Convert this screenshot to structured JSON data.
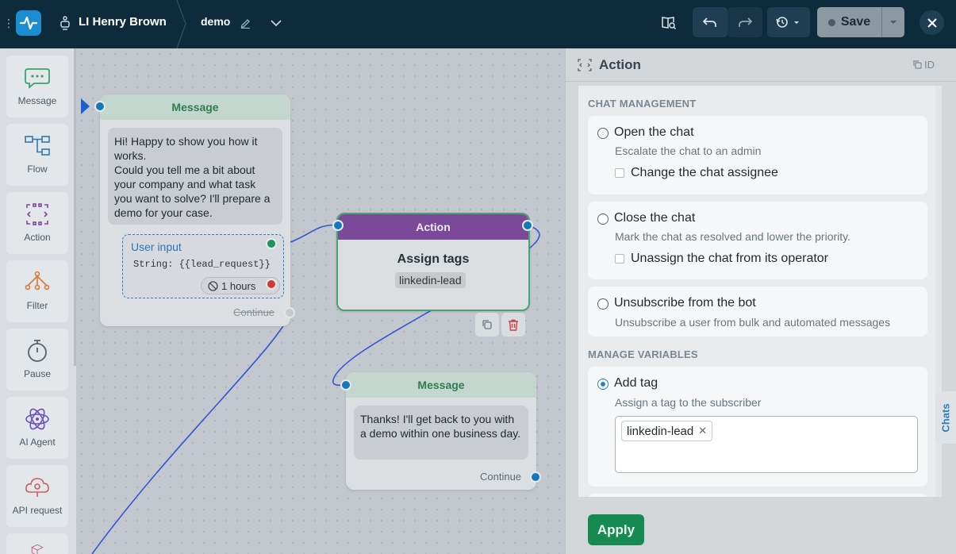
{
  "topbar": {
    "bot_name": "LI Henry Brown",
    "flow_name": "demo",
    "save_label": "Save"
  },
  "palette": {
    "items": [
      {
        "label": "Message",
        "icon": "chat-bubble-icon"
      },
      {
        "label": "Flow",
        "icon": "flow-icon"
      },
      {
        "label": "Action",
        "icon": "action-icon"
      },
      {
        "label": "Filter",
        "icon": "filter-icon"
      },
      {
        "label": "Pause",
        "icon": "stopwatch-icon"
      },
      {
        "label": "AI Agent",
        "icon": "atom-icon"
      },
      {
        "label": "API request",
        "icon": "api-cloud-icon"
      }
    ]
  },
  "canvas": {
    "message1": {
      "header": "Message",
      "text": "Hi! Happy to show you how it works.\nCould you tell me a bit about your company and what task you want to solve? I'll prepare a demo for your case.",
      "user_input_label": "User input",
      "user_input_var": "String: {{lead_request}}",
      "timeout": "1 hours",
      "continue_label": "Continue"
    },
    "action": {
      "header": "Action",
      "title": "Assign tags",
      "tag": "linkedin-lead"
    },
    "message2": {
      "header": "Message",
      "text": "Thanks! I'll get back to you with a demo within one business day.",
      "continue_label": "Continue"
    }
  },
  "panel": {
    "title": "Action",
    "id_label": "ID",
    "sections": {
      "chat_management": "CHAT MANAGEMENT",
      "manage_variables": "MANAGE VARIABLES"
    },
    "options": {
      "open_chat": {
        "label": "Open the chat",
        "desc": "Escalate the chat to an admin",
        "check": "Change the chat assignee",
        "selected": false
      },
      "close_chat": {
        "label": "Close the chat",
        "desc": "Mark the chat as resolved and lower the priority.",
        "check": "Unassign the chat from its operator",
        "selected": false
      },
      "unsubscribe": {
        "label": "Unsubscribe from the bot",
        "desc": "Unsubscribe a user from bulk and automated messages",
        "selected": false
      },
      "add_tag": {
        "label": "Add tag",
        "desc": "Assign a tag to the subscriber",
        "tags": [
          "linkedin-lead"
        ],
        "selected": true
      }
    },
    "apply_label": "Apply",
    "side_tab": "Chats"
  },
  "colors": {
    "topbar_bg": "#0e2b3c",
    "accent_green": "#178a52",
    "action_purple": "#7a4a99",
    "link_blue": "#2a7fd6"
  }
}
